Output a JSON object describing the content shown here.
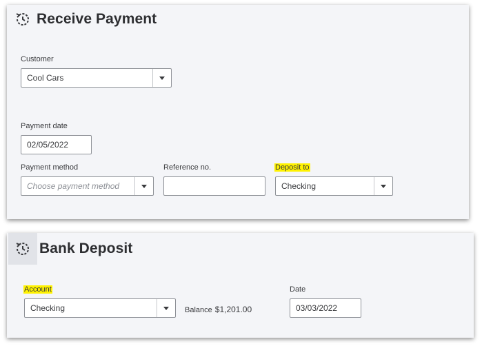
{
  "receive_payment": {
    "title": "Receive Payment",
    "customer_label": "Customer",
    "customer_value": "Cool Cars",
    "payment_date_label": "Payment date",
    "payment_date_value": "02/05/2022",
    "payment_method_label": "Payment method",
    "payment_method_placeholder": "Choose payment method",
    "reference_label": "Reference no.",
    "reference_value": "",
    "deposit_to_label": "Deposit to",
    "deposit_to_value": "Checking"
  },
  "bank_deposit": {
    "title": "Bank Deposit",
    "account_label": "Account",
    "account_value": "Checking",
    "balance_label": "Balance",
    "balance_value": "$1,201.00",
    "date_label": "Date",
    "date_value": "03/03/2022"
  },
  "colors": {
    "highlight": "#fff200",
    "panel_bg": "#f4f5f8",
    "text": "#393a3d"
  }
}
